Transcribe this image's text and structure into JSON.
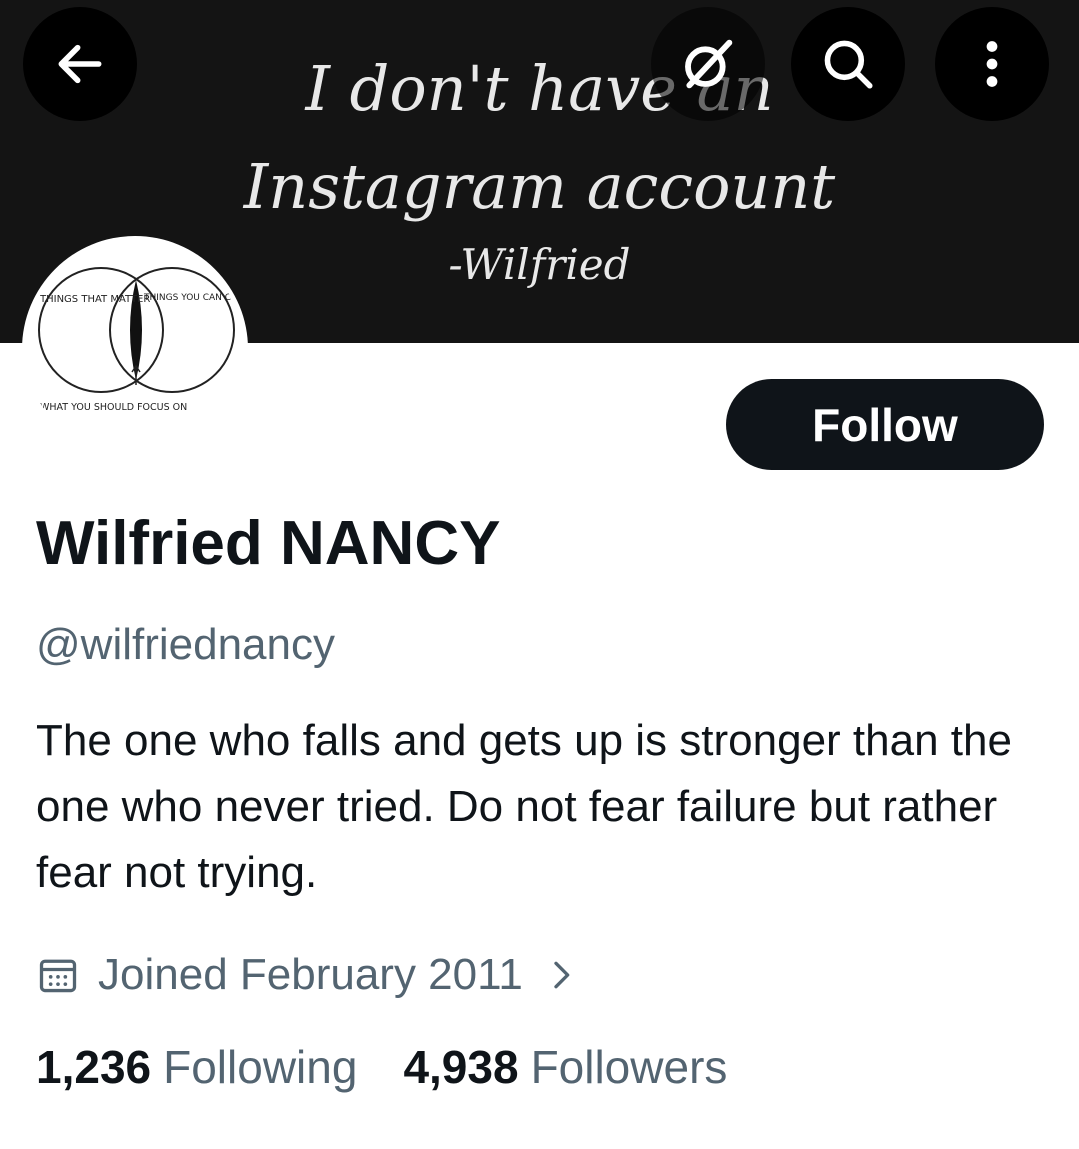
{
  "banner": {
    "line1": "I don't have an",
    "line2": "Instagram account",
    "line3": "-Wilfried",
    "background": "#141414"
  },
  "header": {
    "icons": [
      "back-arrow-icon",
      "grok-icon",
      "search-icon",
      "more-vertical-icon"
    ]
  },
  "avatar": {
    "label_left": "THINGS THAT MATTER",
    "label_right": "THINGS YOU CAN CONTROL",
    "label_bottom": "WHAT YOU SHOULD FOCUS ON"
  },
  "profile": {
    "follow_label": "Follow",
    "display_name": "Wilfried NANCY",
    "handle": "@wilfriednancy",
    "bio": "The one who falls and gets up is stronger than the one who never tried. Do not fear failure but rather fear not trying.",
    "joined": "Joined February 2011",
    "following_count": "1,236",
    "following_label": "Following",
    "followers_count": "4,938",
    "followers_label": "Followers"
  },
  "colors": {
    "primary_text": "#0f1419",
    "secondary_text": "#536471",
    "button_bg": "#0f1419"
  }
}
